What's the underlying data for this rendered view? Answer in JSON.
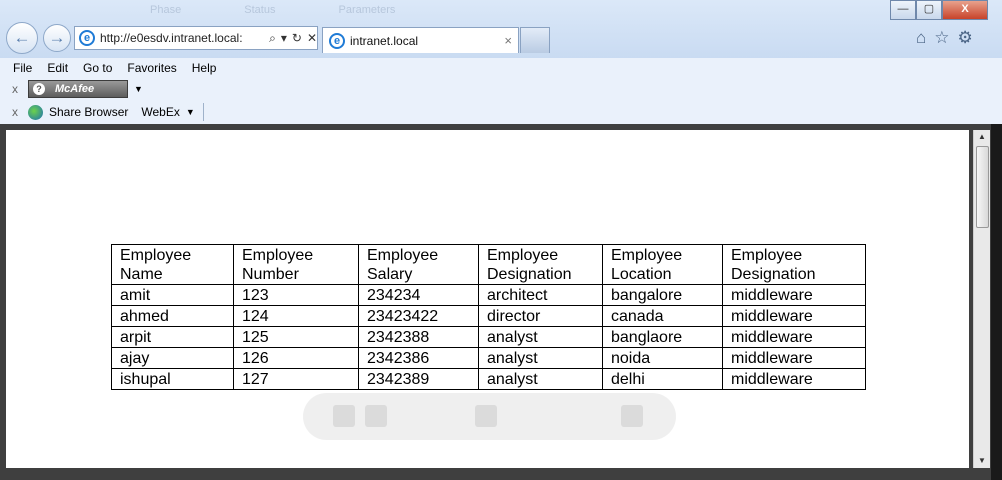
{
  "browser": {
    "background_tabs": [
      "Phase",
      "Status",
      "Parameters"
    ],
    "address_url": "http://e0esdv.intranet.local:",
    "tab_title": "intranet.local",
    "tab_close": "×",
    "window_buttons": {
      "minimize": "—",
      "maximize": "▢",
      "close": "X"
    },
    "icons": {
      "home": "⌂",
      "favorites": "☆",
      "tools": "⚙"
    }
  },
  "menu": {
    "items": [
      "File",
      "Edit",
      "Go to",
      "Favorites",
      "Help"
    ]
  },
  "toolbar": {
    "close_glyph": "x",
    "mcafee_label": "McAfee",
    "share_browser": "Share Browser",
    "webex": "WebEx"
  },
  "table": {
    "headers": [
      [
        "Employee",
        "Name"
      ],
      [
        "Employee",
        "Number"
      ],
      [
        "Employee",
        "Salary"
      ],
      [
        "Employee",
        "Designation"
      ],
      [
        "Employee",
        "Location"
      ],
      [
        "Employee",
        "Designation"
      ]
    ],
    "rows": [
      [
        "amit",
        "123",
        "234234",
        "architect",
        "bangalore",
        "middleware"
      ],
      [
        "ahmed",
        "124",
        "23423422",
        "director",
        "canada",
        "middleware"
      ],
      [
        "arpit",
        "125",
        "2342388",
        "analyst",
        "banglaore",
        "middleware"
      ],
      [
        "ajay",
        "126",
        "2342386",
        "analyst",
        "noida",
        "middleware"
      ],
      [
        "ishupal",
        "127",
        "2342389",
        "analyst",
        "delhi",
        "middleware"
      ]
    ]
  }
}
